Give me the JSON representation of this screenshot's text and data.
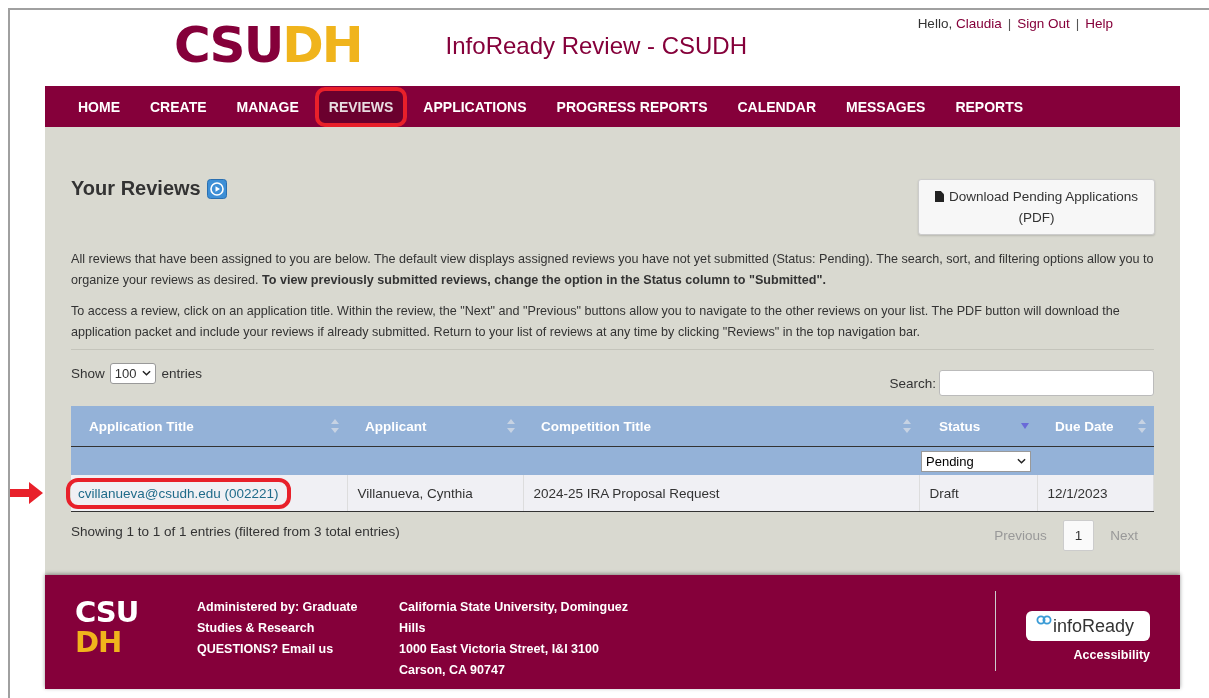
{
  "logo": [
    {
      "text": "CSU",
      "kind": "primary"
    },
    {
      "text": "DH",
      "kind": "accent"
    }
  ],
  "site_title": "InfoReady Review - CSUDH",
  "user_links": [
    {
      "text": "Hello, ",
      "kind": "plain"
    },
    {
      "text": "Claudia",
      "kind": "link"
    },
    {
      "text": "|",
      "kind": "sep"
    },
    {
      "text": "Sign Out",
      "kind": "link"
    },
    {
      "text": "|",
      "kind": "sep"
    },
    {
      "text": "Help",
      "kind": "link"
    }
  ],
  "nav": [
    {
      "label": "HOME",
      "selected": false,
      "circled": false
    },
    {
      "label": "CREATE",
      "selected": false,
      "circled": false
    },
    {
      "label": "MANAGE",
      "selected": false,
      "circled": false
    },
    {
      "label": "REVIEWS",
      "selected": true,
      "circled": true
    },
    {
      "label": "APPLICATIONS",
      "selected": false,
      "circled": false
    },
    {
      "label": "PROGRESS REPORTS",
      "selected": false,
      "circled": false
    },
    {
      "label": "CALENDAR",
      "selected": false,
      "circled": false
    },
    {
      "label": "MESSAGES",
      "selected": false,
      "circled": false
    },
    {
      "label": "REPORTS",
      "selected": false,
      "circled": false
    }
  ],
  "heading": "Your Reviews",
  "download_button": "Download Pending Applications (PDF)",
  "paragraphs": [
    "All reviews that have been assigned to you are below. The default view displays assigned reviews you have not yet submitted (Status: Pending). The search, sort, and filtering options allow you to organize your reviews as desired. **To view previously submitted reviews, change the option in the Status column to \"Submitted\".**",
    "To access a review, click on an application title. Within the review, the \"Next\" and \"Previous\" buttons allow you to navigate to the other reviews on your list. The PDF button will download the application packet and include your reviews if already submitted. Return to your list of reviews at any time by clicking \"Reviews\" in the top navigation bar."
  ],
  "show_entries": {
    "label_before": "Show",
    "value": "100",
    "label_after": "entries"
  },
  "search": {
    "label": "Search:"
  },
  "table": {
    "columns": [
      {
        "label": "Application Title",
        "sorted": false
      },
      {
        "label": "Applicant",
        "sorted": false
      },
      {
        "label": "Competition Title",
        "sorted": false
      },
      {
        "label": "Status",
        "sorted": true
      },
      {
        "label": "Due Date",
        "sorted": false
      }
    ],
    "status_filter": "Pending",
    "rows": [
      {
        "application_title": "cvillanueva@csudh.edu (002221)",
        "circled": true,
        "arrow": true,
        "applicant": "Villanueva, Cynthia",
        "competition_title": "2024-25 IRA Proposal Request",
        "status": "Draft",
        "due_date": "12/1/2023"
      }
    ]
  },
  "table_info": "Showing 1 to 1 of 1 entries (filtered from 3 total entries)",
  "pagination": [
    {
      "label": "Previous",
      "disabled": true,
      "selected": false
    },
    {
      "label": "1",
      "disabled": false,
      "selected": true
    },
    {
      "label": "Next",
      "disabled": true,
      "selected": false
    }
  ],
  "footer": {
    "logo": [
      {
        "text": "CSU",
        "kind": "primary"
      },
      {
        "text": "DH",
        "kind": "accent"
      }
    ],
    "admin": "Administered by: Graduate Studies & Research",
    "questions": "QUESTIONS?",
    "email_link": "Email us",
    "address": [
      "California State University, Dominguez Hills",
      "1000 East Victoria Street, I&I 3100",
      "Carson, CA 90747"
    ],
    "partner_logo": "infoReady",
    "accessibility": "Accessibility"
  }
}
